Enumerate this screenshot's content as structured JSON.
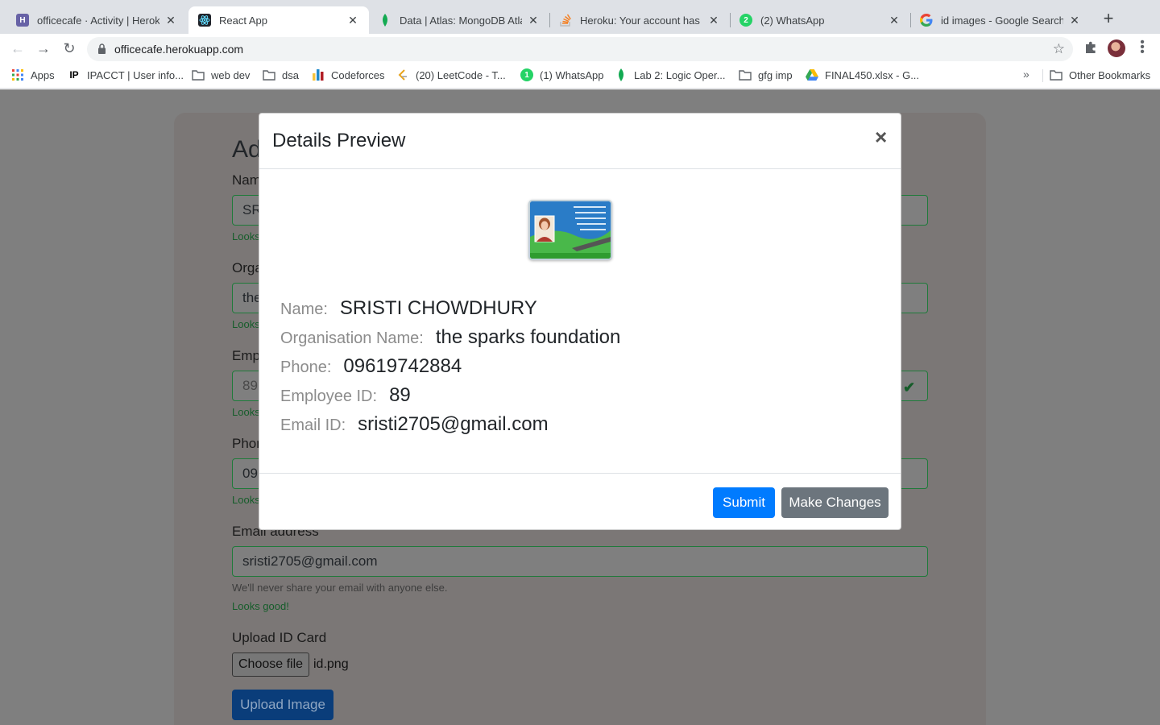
{
  "browser": {
    "tabs": [
      {
        "title": "officecafe · Activity | Heroku",
        "icon": "heroku-icon",
        "color": "#6762a6"
      },
      {
        "title": "React App",
        "icon": "react-icon",
        "color": "#61dafb",
        "active": true
      },
      {
        "title": "Data | Atlas: MongoDB Atlas",
        "icon": "mongodb-leaf-icon",
        "color": "#13aa52"
      },
      {
        "title": "Heroku: Your account has re",
        "icon": "stackoverflow-icon",
        "color": "#f48024"
      },
      {
        "title": "(2) WhatsApp",
        "icon": "whatsapp-icon",
        "color": "#25d366",
        "badge": "2"
      },
      {
        "title": "id images - Google Search",
        "icon": "google-icon",
        "color": "#4285f4"
      }
    ],
    "url": "officecafe.herokuapp.com",
    "bookmarks": [
      {
        "label": "Apps",
        "icon": "apps-grid-icon"
      },
      {
        "label": "IPACCT | User info...",
        "icon": "ipacct-icon"
      },
      {
        "label": "web dev",
        "icon": "folder-icon"
      },
      {
        "label": "dsa",
        "icon": "folder-icon"
      },
      {
        "label": "Codeforces",
        "icon": "codeforces-icon"
      },
      {
        "label": "(20) LeetCode - T...",
        "icon": "leetcode-icon"
      },
      {
        "label": "(1) WhatsApp",
        "icon": "whatsapp-icon"
      },
      {
        "label": "Lab 2: Logic Oper...",
        "icon": "mongodb-leaf-icon"
      },
      {
        "label": "gfg imp",
        "icon": "folder-icon"
      },
      {
        "label": "FINAL450.xlsx - G...",
        "icon": "google-drive-icon"
      }
    ],
    "chevron": "»",
    "other_bookmarks": "Other Bookmarks"
  },
  "form": {
    "heading": "Ad",
    "name_label": "Nam",
    "name_value": "SR",
    "org_label": "Orga",
    "org_value": "the",
    "emp_label": "Emp",
    "emp_value": "89",
    "phone_label": "Phon",
    "phone_value": "09",
    "valid_text": "Looks good!",
    "valid_partial": "Looks",
    "email_label": "Email address",
    "email_value": "sristi2705@gmail.com",
    "email_help": "We'll never share your email with anyone else.",
    "upload_label": "Upload ID Card",
    "choose_file": "Choose file",
    "file_name": "id.png",
    "upload_button": "Upload Image"
  },
  "modal": {
    "title": "Details Preview",
    "close": "×",
    "fields": [
      {
        "key": "Name:",
        "value": "SRISTI CHOWDHURY"
      },
      {
        "key": "Organisation Name:",
        "value": "the sparks foundation"
      },
      {
        "key": "Phone:",
        "value": "09619742884"
      },
      {
        "key": "Employee ID:",
        "value": "89"
      },
      {
        "key": "Email ID:",
        "value": "sristi2705@gmail.com"
      }
    ],
    "submit": "Submit",
    "make_changes": "Make Changes"
  },
  "colors": {
    "primary": "#007bff",
    "secondary": "#6c757d",
    "valid": "#28a745"
  }
}
